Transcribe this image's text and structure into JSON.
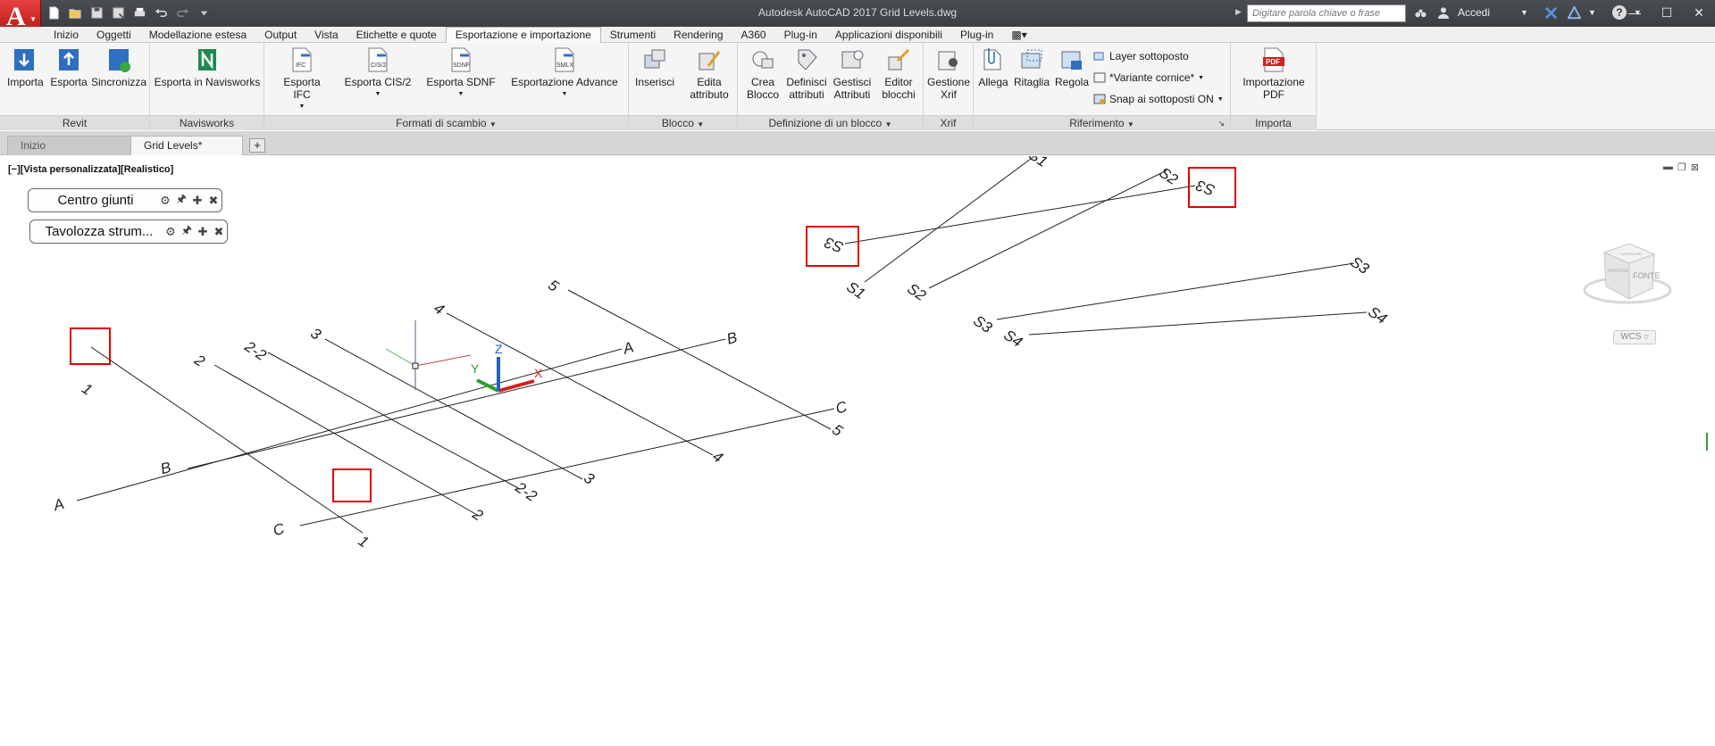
{
  "titlebar": {
    "app_letter": "A",
    "title": "Autodesk AutoCAD 2017    Grid Levels.dwg",
    "search_placeholder": "Digitare parola chiave o frase",
    "signin": "Accedi",
    "help": "?"
  },
  "qat": [
    "new-icon",
    "open-icon",
    "save-icon",
    "saveas-icon",
    "print-icon",
    "undo-icon",
    "redo-icon",
    "customize-icon"
  ],
  "ribbon_tabs": [
    {
      "label": "Inizio",
      "active": false
    },
    {
      "label": "Oggetti",
      "active": false
    },
    {
      "label": "Modellazione estesa",
      "active": false
    },
    {
      "label": "Output",
      "active": false
    },
    {
      "label": "Vista",
      "active": false
    },
    {
      "label": "Etichette e quote",
      "active": false
    },
    {
      "label": "Esportazione e importazione",
      "active": true
    },
    {
      "label": "Strumenti",
      "active": false
    },
    {
      "label": "Rendering",
      "active": false
    },
    {
      "label": "A360",
      "active": false
    },
    {
      "label": "Plug-in",
      "active": false
    },
    {
      "label": "Applicazioni disponibili",
      "active": false
    },
    {
      "label": "Plug-in",
      "active": false
    }
  ],
  "panels": {
    "revit": {
      "title": "Revit",
      "buttons": [
        "Importa",
        "Esporta",
        "Sincronizza"
      ]
    },
    "navisworks": {
      "title": "Navisworks",
      "buttons": [
        "Esporta in Navisworks"
      ]
    },
    "formati": {
      "title": "Formati di scambio",
      "buttons": [
        "Esporta IFC",
        "Esporta CIS/2",
        "Esporta SDNF",
        "Esportazione Advance"
      ],
      "icon_tags": [
        "IFC",
        "CIS/2",
        "SDNF",
        "SMLX"
      ]
    },
    "blocco": {
      "title": "Blocco",
      "buttons": [
        "Inserisci",
        "Edita",
        "attributo"
      ]
    },
    "definizione": {
      "title": "Definizione di un blocco",
      "buttons": [
        [
          "Crea",
          "Blocco"
        ],
        [
          "Definisci",
          "attributi"
        ],
        [
          "Gestisci",
          "Attributi"
        ],
        [
          "Editor",
          "blocchi"
        ]
      ]
    },
    "xrif": {
      "title": "Xrif",
      "buttons": [
        [
          "Gestione",
          "Xrif"
        ]
      ]
    },
    "riferimento": {
      "title": "Riferimento",
      "buttons": [
        "Allega",
        "Ritaglia",
        "Regola"
      ],
      "rows": [
        "Layer sottoposto",
        "*Variante cornice*",
        "Snap ai sottoposti ON"
      ]
    },
    "importa": {
      "title": "Importa",
      "buttons": [
        [
          "Importazione",
          "PDF"
        ]
      ],
      "icon_tag": "PDF"
    }
  },
  "doc_tabs": [
    {
      "label": "Inizio",
      "active": false
    },
    {
      "label": "Grid Levels*",
      "active": true
    }
  ],
  "add_tab": "+",
  "viewport": {
    "label": "[−][Vista personalizzata][Realistico]",
    "palettes": [
      "Centro giunti",
      "Tavolozza strum..."
    ],
    "wcs": "WCS",
    "viewcube_face": "FONTE",
    "viewcube_left": "SINISTRA",
    "viewcube_top": "SUPERIORE"
  },
  "grid_labels": {
    "lettered": [
      "A",
      "A",
      "B",
      "B",
      "C",
      "C"
    ],
    "numbered": [
      "1",
      "1",
      "2",
      "2",
      "2-2",
      "2-2",
      "3",
      "3",
      "4",
      "4",
      "5",
      "5"
    ],
    "sections": [
      "S1",
      "S1",
      "S2",
      "S2",
      "S3",
      "S3",
      "S3",
      "S3",
      "S4",
      "S4"
    ]
  },
  "colors": {
    "accent_red": "#e00000",
    "axis_x": "#d22020",
    "axis_y": "#2aa02a",
    "axis_z": "#2060c8",
    "ribbon_bg": "#f5f5f5",
    "titlebar": "#3f4246"
  }
}
